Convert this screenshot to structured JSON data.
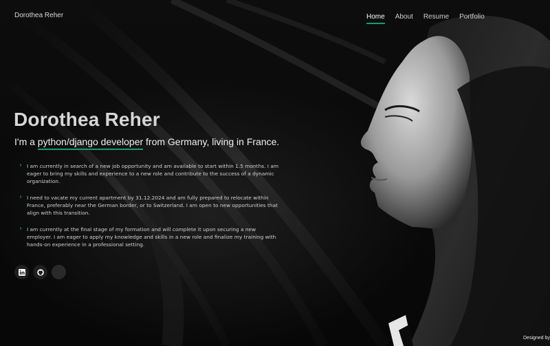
{
  "site": {
    "name": "Dorothea Reher"
  },
  "nav": {
    "items": [
      {
        "label": "Home",
        "active": true
      },
      {
        "label": "About",
        "active": false
      },
      {
        "label": "Resume",
        "active": false
      },
      {
        "label": "Portfolio",
        "active": false
      }
    ]
  },
  "hero": {
    "title": "Dorothea Reher",
    "subtitle_prefix": "I'm a",
    "subtitle_role": "python/django developer",
    "subtitle_suffix": "from Germany, living in France.",
    "bullets": [
      "I am currently in search of a new job opportunity and am available to start within 1.5 months. I am eager to bring my skills and experience to a new role and contribute to the success of a dynamic organization.",
      "I need to vacate my current apartment by 31.12.2024 and am fully prepared to relocate within France, preferably near the German border, or to Switzerland. I am open to new opportunities that align with this transition.",
      "I am currently at the final stage of my formation and will complete it upon securing a new employer. I am eager to apply my knowledge and skills in a new role and finalize my training with hands-on experience in a professional setting."
    ]
  },
  "social": {
    "items": [
      {
        "icon": "linkedin-icon"
      },
      {
        "icon": "github-icon"
      },
      {
        "icon": "blank-icon"
      }
    ]
  },
  "footer": {
    "credits": "Designed by"
  },
  "colors": {
    "accent": "#149f6e",
    "background": "#050505",
    "text": "#ffffff"
  }
}
